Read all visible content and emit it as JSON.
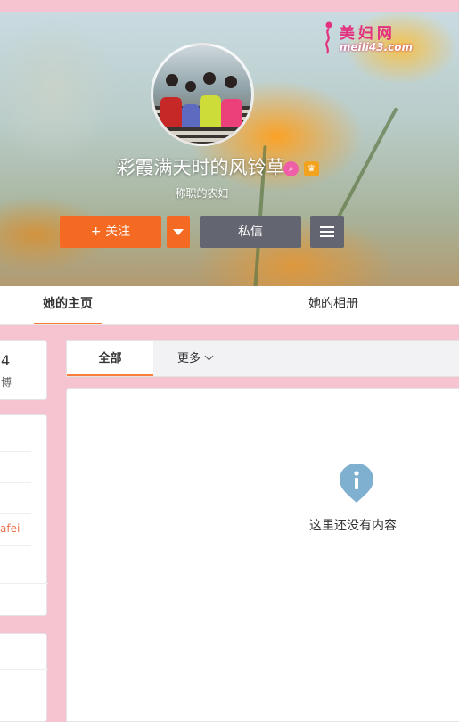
{
  "brand": {
    "top": "美妇网",
    "bottom": "meili43.com"
  },
  "profile": {
    "name": "彩霞满天时的风铃草",
    "subtitle": "称职的农妇"
  },
  "actions": {
    "follow_label": "+ 关注",
    "message_label": "私信"
  },
  "tabs": [
    {
      "label": "她的主页",
      "active": true
    },
    {
      "label": "她的相册",
      "active": false
    }
  ],
  "sidebar": {
    "stat_value": "4",
    "stat_label": "博",
    "link_text": "afei"
  },
  "feed": {
    "tabs": [
      {
        "label": "全部",
        "active": true
      },
      {
        "label": "更多"
      }
    ],
    "empty_text": "这里还没有内容"
  },
  "colors": {
    "accent": "#f56a22",
    "tab_underline": "#fa7d3c",
    "secondary_button": "#636670",
    "page_background": "#f6c4d0",
    "brand": "#e3317f",
    "info_icon": "#7fb0d0"
  },
  "icons": [
    "brand-logo-icon",
    "search-badge-icon",
    "vip-badge-icon",
    "dropdown-caret-icon",
    "menu-icon",
    "chevron-down-icon",
    "info-icon"
  ]
}
